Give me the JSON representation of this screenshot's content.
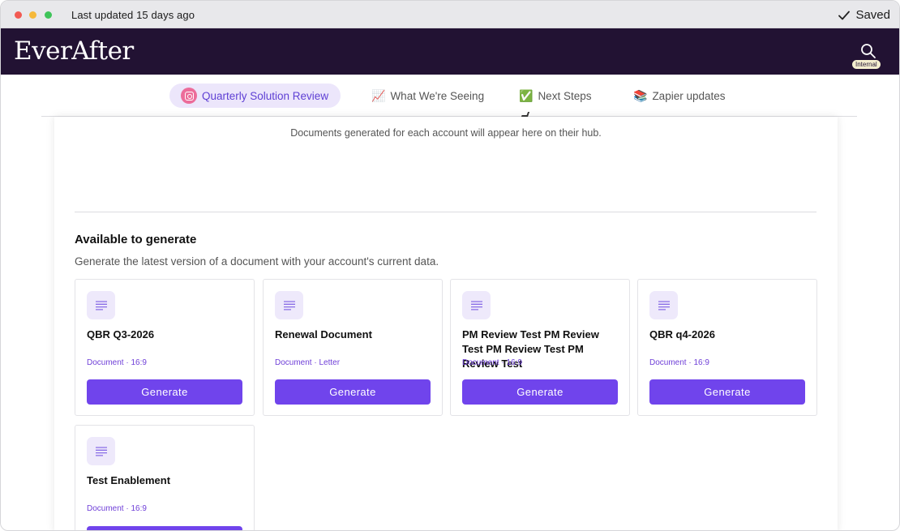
{
  "titlebar": {
    "last_updated": "Last updated 15 days ago",
    "saved_label": "Saved"
  },
  "brand": {
    "logo": "EverAfter",
    "search_badge": "Internal"
  },
  "tabs": [
    {
      "label": "Quarterly Solution Review",
      "icon": "instagram-icon",
      "active": true
    },
    {
      "label": "What We're Seeing",
      "emoji": "📈",
      "active": false
    },
    {
      "label": "Next Steps",
      "emoji": "✅",
      "active": false
    },
    {
      "label": "Zapier updates",
      "emoji": "📚",
      "active": false
    }
  ],
  "content": {
    "empty_message": "Documents generated for each account will appear here on their hub.",
    "section_title": "Available to generate",
    "section_description": "Generate the latest version of a document with your account's current data.",
    "generate_label": "Generate",
    "documents": [
      {
        "title": "QBR Q3-2026",
        "meta": "Document · 16:9"
      },
      {
        "title": "Renewal Document",
        "meta": "Document · Letter"
      },
      {
        "title": "PM Review Test PM Review Test PM Review Test PM Review Test",
        "meta": "Document · 16:9"
      },
      {
        "title": "QBR q4-2026",
        "meta": "Document · 16:9"
      },
      {
        "title": "Test Enablement",
        "meta": "Document · 16:9"
      }
    ]
  },
  "colors": {
    "brand_bg": "#221233",
    "accent": "#7044ec",
    "tab_active_bg": "#ece6fb"
  }
}
